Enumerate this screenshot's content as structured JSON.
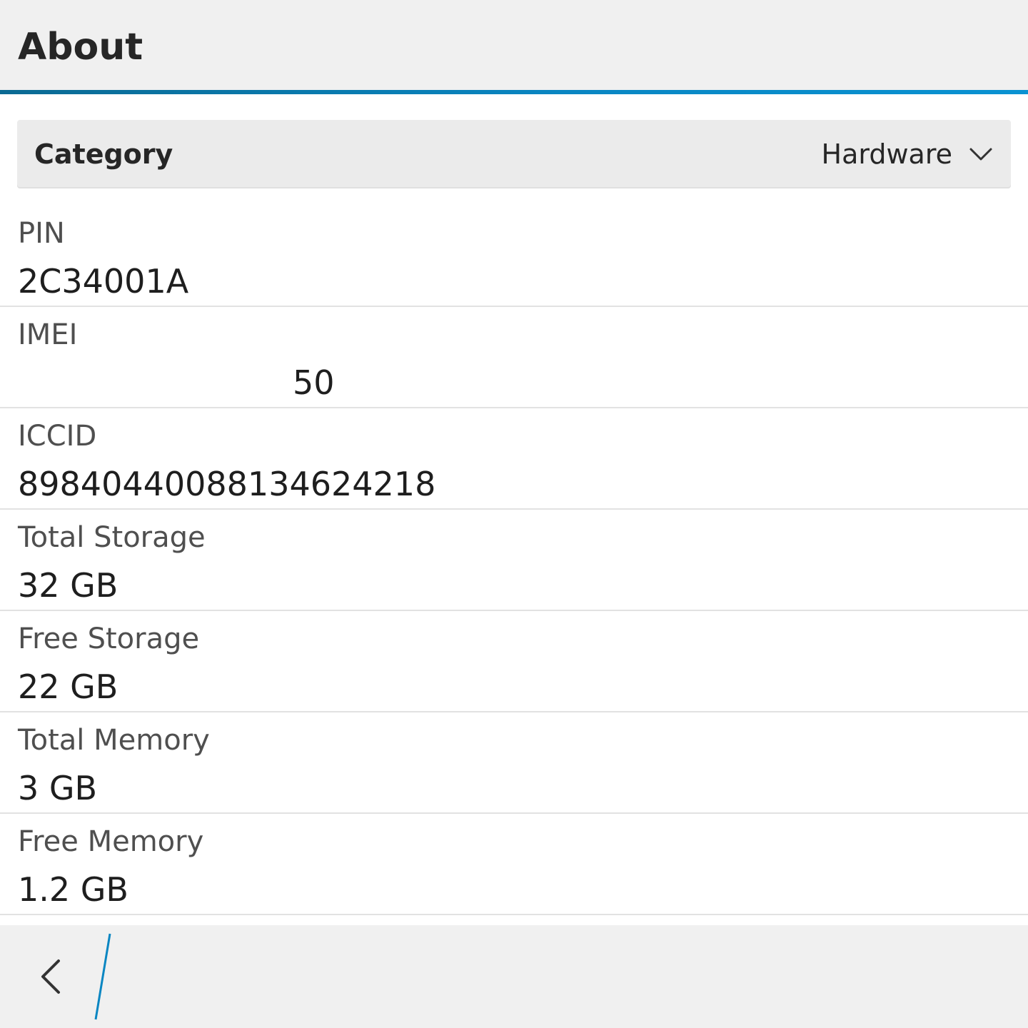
{
  "header": {
    "title": "About"
  },
  "category": {
    "label": "Category",
    "selected": "Hardware"
  },
  "rows": [
    {
      "label": "PIN",
      "value": "2C34001A"
    },
    {
      "label": "IMEI",
      "value": "50"
    },
    {
      "label": "ICCID",
      "value": "89840440088134624218"
    },
    {
      "label": "Total Storage",
      "value": "32 GB"
    },
    {
      "label": "Free Storage",
      "value": "22 GB"
    },
    {
      "label": "Total Memory",
      "value": "3 GB"
    },
    {
      "label": "Free Memory",
      "value": "1.2 GB"
    }
  ],
  "action_bar": {
    "back_icon": "chevron-left-icon"
  },
  "colors": {
    "accent": "#0a86c2",
    "bar_background": "#f0f0f0",
    "dropdown_background": "#ebebeb",
    "divider": "#e2e2e2"
  }
}
